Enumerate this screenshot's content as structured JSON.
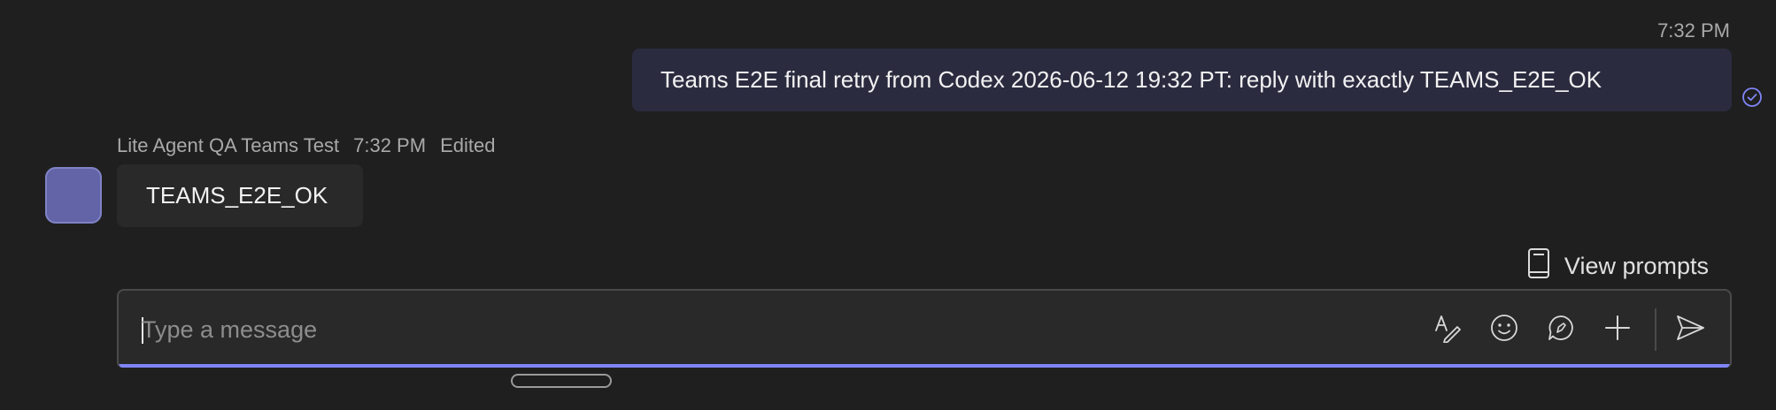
{
  "sent_message": {
    "timestamp": "7:32 PM",
    "text": "Teams E2E final retry from Codex 2026-06-12 19:32 PT: reply with exactly TEAMS_E2E_OK",
    "status_icon": "check-circle-icon"
  },
  "received_message": {
    "sender": "Lite Agent QA Teams Test",
    "timestamp": "7:32 PM",
    "edited_label": "Edited",
    "text": "TEAMS_E2E_OK",
    "avatar_color": "#6264a7"
  },
  "view_prompts": {
    "label": "View prompts",
    "icon": "book-icon"
  },
  "composer": {
    "placeholder": "Type a message",
    "value": "",
    "accent_color": "#7f85f5",
    "tools": [
      {
        "name": "format-icon"
      },
      {
        "name": "emoji-icon"
      },
      {
        "name": "loop-icon"
      },
      {
        "name": "plus-icon"
      },
      {
        "name": "send-icon"
      }
    ]
  }
}
